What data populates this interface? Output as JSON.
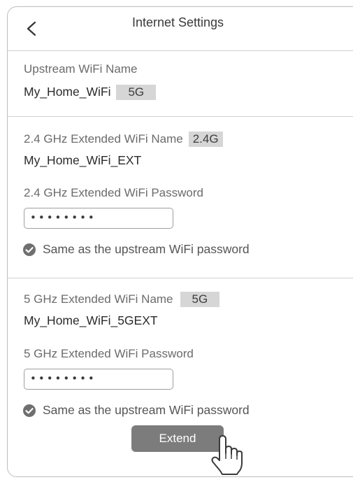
{
  "header": {
    "title": "Internet Settings",
    "back_icon": "chevron-left-icon"
  },
  "upstream": {
    "label": "Upstream WiFi Name",
    "value": "My_Home_WiFi",
    "band": "5G"
  },
  "band24": {
    "name_label": "2.4 GHz Extended WiFi Name",
    "band": "2.4G",
    "name_value": "My_Home_WiFi_EXT",
    "password_label": "2.4 GHz Extended WiFi Password",
    "password_value": "••••••••",
    "same_label": "Same as the upstream WiFi password",
    "same_checked": true
  },
  "band5": {
    "name_label": "5 GHz Extended WiFi Name",
    "band": "5G",
    "name_value": "My_Home_WiFi_5GEXT",
    "password_label": "5 GHz Extended WiFi Password",
    "password_value": "••••••••",
    "same_label": "Same as the upstream WiFi password",
    "same_checked": true
  },
  "actions": {
    "extend_label": "Extend",
    "pointer_icon": "hand-pointer-icon"
  },
  "colors": {
    "button": "#7c7c7c",
    "badge": "#d6d6d6",
    "divider": "#cfcfcf"
  }
}
